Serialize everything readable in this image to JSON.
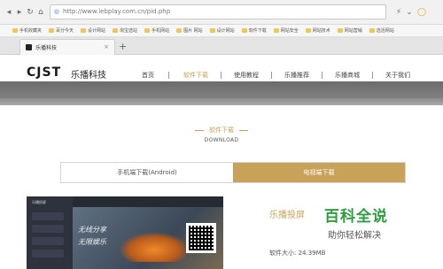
{
  "browser": {
    "url": "http://www.lebplay.com.cn/pid.php",
    "bookmarks": [
      "手机收藏夹",
      "百分今天",
      "设计网站",
      "淘宝选站",
      "手机网站",
      "图片 网站",
      "设计网站",
      "软件下载",
      "网站安全",
      "网站技术",
      "网站营销",
      "选活网站"
    ],
    "tab_title": "乐播科技",
    "tab_close": "×",
    "new_tab": "+"
  },
  "site": {
    "logo_mark": "CJST",
    "logo_text": "乐播科技",
    "nav": [
      "首页",
      "软件下载",
      "使用教程",
      "乐播推荐",
      "乐播商城",
      "关于我们"
    ],
    "active_nav_index": 1,
    "accent_color": "#c9a25a"
  },
  "section": {
    "title": "软件下载",
    "subtitle": "DOWNLOAD"
  },
  "download_tabs": [
    {
      "label": "手机端下载(Android)",
      "active": false
    },
    {
      "label": "电视端下载",
      "active": true
    }
  ],
  "preview": {
    "logo": "乐播投屏",
    "slogan1": "无线分享",
    "slogan2": "无限娱乐"
  },
  "product": {
    "name": "乐播投屏",
    "size_label": "软件大小: 24.39MB"
  },
  "watermark": {
    "main": "百科全说",
    "sub": "助你轻松解决"
  }
}
